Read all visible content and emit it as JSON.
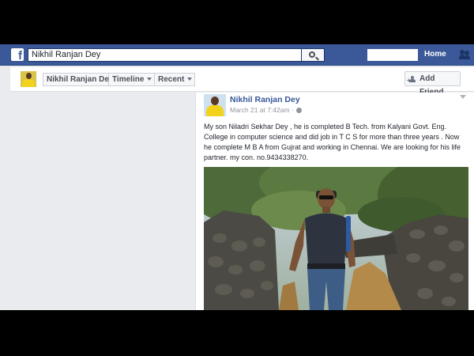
{
  "header": {
    "search_value": "Nikhil Ranjan Dey",
    "logo": "f",
    "home_label": "Home",
    "colors": {
      "brand_blue": "#3b5998",
      "link_blue": "#365899"
    }
  },
  "subnav": {
    "profile_name": "Nikhil Ranjan Dey",
    "timeline_label": "Timeline",
    "recent_label": "Recent",
    "add_friend_label": "Add Friend"
  },
  "post": {
    "author": "Nikhil Ranjan Dey",
    "timestamp": "March 21 at 7:42am",
    "audience_icon": "globe-icon",
    "text": "My son Niladri Sekhar Dey , he is completed B Tech. from Kalyani Govt. Eng. College in computer science and did job in T C S for more than three years . Now he complete M B A from Gujrat and working in Chennai. We are looking for his life partner. my con. no.9434338270."
  }
}
